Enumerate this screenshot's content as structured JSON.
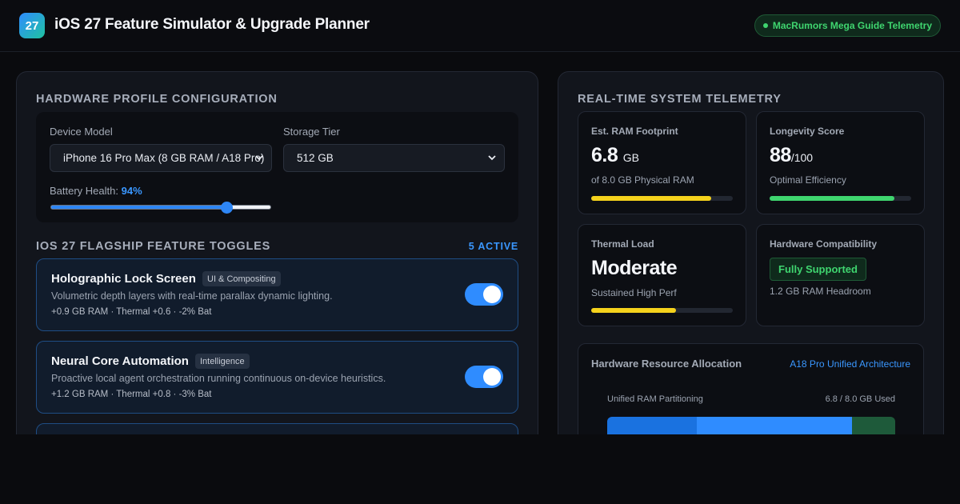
{
  "header": {
    "logo_text": "27",
    "title": "iOS 27 Feature Simulator & Upgrade Planner",
    "telemetry_badge": "MacRumors Mega Guide Telemetry"
  },
  "hardware": {
    "section_title": "Hardware Profile Configuration",
    "device_label": "Device Model",
    "device_value": "iPhone 16 Pro Max (8 GB RAM / A18 Pro)",
    "storage_label": "Storage Tier",
    "storage_value": "512 GB",
    "battery_label": "Battery Health:",
    "battery_value": "94%",
    "battery_level": 0.8
  },
  "features": {
    "section_title": "iOS 27 Flagship Feature Toggles",
    "active_count": "5 ACTIVE",
    "items": [
      {
        "name": "Holographic Lock Screen",
        "tag": "UI & Compositing",
        "desc": "Volumetric depth layers with real-time parallax dynamic lighting.",
        "meta": "+0.9 GB RAM · Thermal +0.6 · -2% Bat",
        "enabled": true
      },
      {
        "name": "Neural Core Automation",
        "tag": "Intelligence",
        "desc": "Proactive local agent orchestration running continuous on-device heuristics.",
        "meta": "+1.2 GB RAM · Thermal +0.8 · -3% Bat",
        "enabled": true
      }
    ]
  },
  "telemetry": {
    "section_title": "Real-Time System Telemetry",
    "ram": {
      "label": "Est. RAM Footprint",
      "value": "6.8",
      "unit": "GB",
      "sub": "of 8.0 GB Physical RAM",
      "fill": 0.85,
      "color": "#f5d21c"
    },
    "longevity": {
      "label": "Longevity Score",
      "value": "88",
      "unit": "/100",
      "sub": "Optimal Efficiency",
      "fill": 0.88,
      "color": "#3fd56f"
    },
    "thermal": {
      "label": "Thermal Load",
      "value": "Moderate",
      "sub": "Sustained High Perf",
      "fill": 0.6,
      "color": "#f5d21c"
    },
    "compat": {
      "label": "Hardware Compatibility",
      "badge": "Fully Supported",
      "sub": "1.2 GB RAM Headroom"
    }
  },
  "allocation": {
    "title": "Hardware Resource Allocation",
    "arch": "A18 Pro Unified Architecture",
    "sub": "Unified RAM Partitioning",
    "used": "6.8 / 8.0 GB Used",
    "segments": [
      {
        "share": 0.31,
        "color": "#1a72e0"
      },
      {
        "share": 0.54,
        "color": "#2f8cff"
      },
      {
        "share": 0.15,
        "color": "#1e5a3a"
      }
    ]
  }
}
